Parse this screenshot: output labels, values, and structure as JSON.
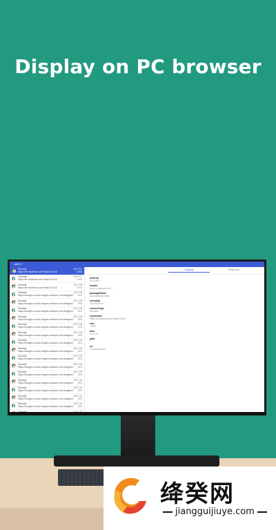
{
  "headline": "Display on PC browser",
  "screen": {
    "titlebar": "vdeli 3",
    "tabs": [
      "Request",
      "Response"
    ],
    "items": [
      {
        "title": "Chrome",
        "url": "https://lh.resahost.com/?batch=1216",
        "time": "02:17:07",
        "size": "1.4KB"
      },
      {
        "title": "Chrome",
        "url": "https://lh.resahost.com/?batch=1216",
        "time": "02:17:07",
        "size": "1.4KB"
      },
      {
        "title": "Chrome",
        "url": "https://lh.resahost.com/?batch=1216",
        "time": "02:17:08",
        "size": "1.4KB"
      },
      {
        "title": "Chrome",
        "url": "https://images-na.ssl-images-amazon.com/images/I/41...",
        "time": "02:17:08",
        "size": "6KB"
      },
      {
        "title": "Chrome",
        "url": "https://images-na.ssl-images-amazon.com/images/I/41...",
        "time": "02:17:08",
        "size": "6KB"
      },
      {
        "title": "Chrome",
        "url": "https://images-na.ssl-images-amazon.com/images/I/41...",
        "time": "02:17:08",
        "size": "6KB"
      },
      {
        "title": "Chrome",
        "url": "https://images-na.ssl-images-amazon.com/images/I/41...",
        "time": "02:17:08",
        "size": "6KB"
      },
      {
        "title": "Chrome",
        "url": "https://images-na.ssl-images-amazon.com/images/I/41...",
        "time": "02:17:08",
        "size": "6KB"
      },
      {
        "title": "Chrome",
        "url": "https://images-na.ssl-images-amazon.com/images/I/41...",
        "time": "02:17:09",
        "size": "6KB"
      },
      {
        "title": "Chrome",
        "url": "https://images-na.ssl-images-amazon.com/images/I/41...",
        "time": "02:17:09",
        "size": "6KB"
      },
      {
        "title": "Chrome",
        "url": "https://images-na.ssl-images-amazon.com/images/I/41...",
        "time": "02:17:09",
        "size": "6KB"
      },
      {
        "title": "Chrome",
        "url": "https://images-na.ssl-images-amazon.com/images/I/41...",
        "time": "02:17:09",
        "size": "6KB"
      },
      {
        "title": "Chrome",
        "url": "https://images-na.ssl-images-amazon.com/images/I/41...",
        "time": "02:17:09",
        "size": "6KB"
      },
      {
        "title": "Chrome",
        "url": "https://images-na.ssl-images-amazon.com/images/I/41...",
        "time": "02:17:09",
        "size": "6KB"
      },
      {
        "title": "Chrome",
        "url": "https://images-na.ssl-images-amazon.com/images/I/41...",
        "time": "02:17:10",
        "size": "6KB"
      },
      {
        "title": "Chrome",
        "url": "https://images-na.ssl-images-amazon.com/images/I/41...",
        "time": "02:17:10",
        "size": "6KB"
      },
      {
        "title": "Chrome",
        "url": "https://images-na.ssl-images-amazon.com/images/I/41...",
        "time": "02:17:10",
        "size": "6KB"
      },
      {
        "title": "Chrome",
        "url": "https://images-na.ssl-images-amazon.com/images/I/41...",
        "time": "02:17:10",
        "size": "6KB"
      },
      {
        "title": "Chrome",
        "url": "https://images-na.ssl-images-amazon.com/images/I/41...",
        "time": "02:17:10",
        "size": "6KB"
      }
    ],
    "details": [
      {
        "label": "method",
        "value": "OPTIONS"
      },
      {
        "label": "header",
        "value": "Host: lh.resahost.com ..."
      },
      {
        "label": "packageName",
        "value": "com.android.chrome"
      },
      {
        "label": "remoteIp",
        "value": "140.205.xx.xx"
      },
      {
        "label": "contentType",
        "value": "text/plain"
      },
      {
        "label": "requestUrl",
        "value": "https://lh.resahost.com/?batch=1216"
      },
      {
        "label": "size",
        "value": "1.4KB"
      },
      {
        "label": "time",
        "value": "02:17:07"
      },
      {
        "label": "path",
        "value": "/"
      },
      {
        "label": "url",
        "value": "lh.resahost.com"
      }
    ]
  },
  "watermark": {
    "title": "绛癸网",
    "url": "jiangguijiuye.com"
  }
}
